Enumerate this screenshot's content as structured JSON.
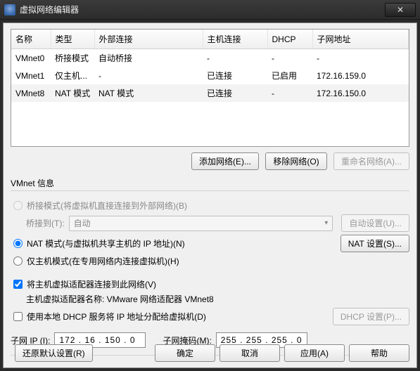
{
  "window": {
    "title": "虚拟网络编辑器",
    "close_glyph": "✕"
  },
  "table": {
    "headers": {
      "name": "名称",
      "type": "类型",
      "ext": "外部连接",
      "host": "主机连接",
      "dhcp": "DHCP",
      "subnet": "子网地址"
    },
    "rows": [
      {
        "name": "VMnet0",
        "type": "桥接模式",
        "ext": "自动桥接",
        "host": "-",
        "dhcp": "-",
        "subnet": "-"
      },
      {
        "name": "VMnet1",
        "type": "仅主机...",
        "ext": "-",
        "host": "已连接",
        "dhcp": "已启用",
        "subnet": "172.16.159.0"
      },
      {
        "name": "VMnet8",
        "type": "NAT 模式",
        "ext": "NAT 模式",
        "host": "已连接",
        "dhcp": "-",
        "subnet": "172.16.150.0"
      }
    ]
  },
  "buttons": {
    "add_net": "添加网络(E)...",
    "remove_net": "移除网络(O)",
    "rename_net": "重命名网络(A)..."
  },
  "info": {
    "title": "VMnet 信息",
    "bridged": "桥接模式(将虚拟机直接连接到外部网络)(B)",
    "bridged_to": "桥接到(T):",
    "bridged_auto": "自动",
    "auto_settings": "自动设置(U)...",
    "nat": "NAT 模式(与虚拟机共享主机的 IP 地址)(N)",
    "nat_settings": "NAT 设置(S)...",
    "hostonly": "仅主机模式(在专用网络内连接虚拟机)(H)",
    "connect_host": "将主机虚拟适配器连接到此网络(V)",
    "adapter_label": "主机虚拟适配器名称: VMware 网络适配器 VMnet8",
    "use_dhcp": "使用本地 DHCP 服务将 IP 地址分配给虚拟机(D)",
    "dhcp_settings": "DHCP 设置(P)..."
  },
  "ip": {
    "subnet_label": "子网 IP (I):",
    "subnet_value": "172 . 16 . 150 . 0",
    "mask_label": "子网掩码(M):",
    "mask_value": "255 . 255 . 255 . 0"
  },
  "footer": {
    "restore": "还原默认设置(R)",
    "ok": "确定",
    "cancel": "取消",
    "apply": "应用(A)",
    "help": "帮助"
  }
}
